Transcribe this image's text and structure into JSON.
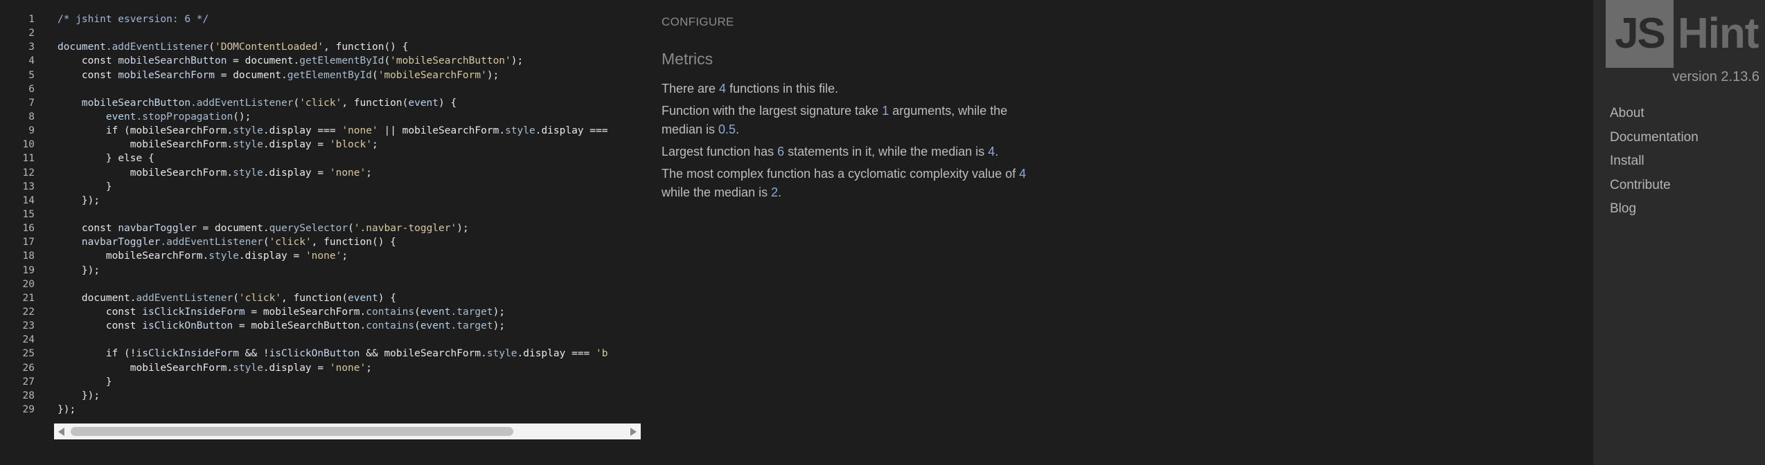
{
  "editor": {
    "line_numbers": [
      "1",
      "2",
      "3",
      "4",
      "5",
      "6",
      "7",
      "8",
      "9",
      "10",
      "11",
      "12",
      "13",
      "14",
      "15",
      "16",
      "17",
      "18",
      "19",
      "20",
      "21",
      "22",
      "23",
      "24",
      "25",
      "26",
      "27",
      "28",
      "29"
    ],
    "lines": [
      [
        [
          "tk-comment",
          "/* jshint esversion: 6 */"
        ]
      ],
      [],
      [
        [
          "tk-var",
          "document"
        ],
        [
          "tk-prop",
          ".addEventListener"
        ],
        [
          "",
          "("
        ],
        [
          "tk-string",
          "'DOMContentLoaded'"
        ],
        [
          "",
          ", "
        ],
        [
          "tk-kw",
          "function"
        ],
        [
          "",
          "() {"
        ]
      ],
      [
        [
          "",
          "    "
        ],
        [
          "tk-kw",
          "const "
        ],
        [
          "tk-var",
          "mobileSearchButton"
        ],
        [
          "",
          " = document."
        ],
        [
          "tk-prop",
          "getElementById"
        ],
        [
          "",
          "("
        ],
        [
          "tk-string",
          "'mobileSearchButton'"
        ],
        [
          "",
          ");"
        ]
      ],
      [
        [
          "",
          "    "
        ],
        [
          "tk-kw",
          "const "
        ],
        [
          "tk-var",
          "mobileSearchForm"
        ],
        [
          "",
          " = document."
        ],
        [
          "tk-prop",
          "getElementById"
        ],
        [
          "",
          "("
        ],
        [
          "tk-string",
          "'mobileSearchForm'"
        ],
        [
          "",
          ");"
        ]
      ],
      [],
      [
        [
          "",
          "    "
        ],
        [
          "tk-var",
          "mobileSearchButton"
        ],
        [
          "tk-prop",
          ".addEventListener"
        ],
        [
          "",
          "("
        ],
        [
          "tk-string",
          "'click'"
        ],
        [
          "",
          ", "
        ],
        [
          "tk-kw",
          "function"
        ],
        [
          "",
          "("
        ],
        [
          "tk-prm",
          "event"
        ],
        [
          "",
          ") {"
        ]
      ],
      [
        [
          "",
          "        "
        ],
        [
          "tk-prm",
          "event"
        ],
        [
          "tk-prop",
          ".stopPropagation"
        ],
        [
          "",
          "();"
        ]
      ],
      [
        [
          "",
          "        "
        ],
        [
          "tk-kw",
          "if "
        ],
        [
          "",
          "(mobileSearchForm."
        ],
        [
          "tk-prop",
          "style"
        ],
        [
          "",
          ".display === "
        ],
        [
          "tk-string",
          "'none'"
        ],
        [
          "",
          " || mobileSearchForm."
        ],
        [
          "tk-prop",
          "style"
        ],
        [
          "",
          ".display === "
        ]
      ],
      [
        [
          "",
          "            mobileSearchForm."
        ],
        [
          "tk-prop",
          "style"
        ],
        [
          "",
          ".display = "
        ],
        [
          "tk-string",
          "'block'"
        ],
        [
          "",
          ";"
        ]
      ],
      [
        [
          "",
          "        } "
        ],
        [
          "tk-kw",
          "else"
        ],
        [
          "",
          " {"
        ]
      ],
      [
        [
          "",
          "            mobileSearchForm."
        ],
        [
          "tk-prop",
          "style"
        ],
        [
          "",
          ".display = "
        ],
        [
          "tk-string",
          "'none'"
        ],
        [
          "",
          ";"
        ]
      ],
      [
        [
          "",
          "        }"
        ]
      ],
      [
        [
          "",
          "    });"
        ]
      ],
      [],
      [
        [
          "",
          "    "
        ],
        [
          "tk-kw",
          "const "
        ],
        [
          "tk-var",
          "navbarToggler"
        ],
        [
          "",
          " = document."
        ],
        [
          "tk-prop",
          "querySelector"
        ],
        [
          "",
          "("
        ],
        [
          "tk-string",
          "'.navbar-toggler'"
        ],
        [
          "",
          ");"
        ]
      ],
      [
        [
          "",
          "    "
        ],
        [
          "tk-var",
          "navbarToggler"
        ],
        [
          "tk-prop",
          ".addEventListener"
        ],
        [
          "",
          "("
        ],
        [
          "tk-string",
          "'click'"
        ],
        [
          "",
          ", "
        ],
        [
          "tk-kw",
          "function"
        ],
        [
          "",
          "() {"
        ]
      ],
      [
        [
          "",
          "        mobileSearchForm."
        ],
        [
          "tk-prop",
          "style"
        ],
        [
          "",
          ".display = "
        ],
        [
          "tk-string",
          "'none'"
        ],
        [
          "",
          ";"
        ]
      ],
      [
        [
          "",
          "    });"
        ]
      ],
      [],
      [
        [
          "",
          "    document."
        ],
        [
          "tk-prop",
          "addEventListener"
        ],
        [
          "",
          "("
        ],
        [
          "tk-string",
          "'click'"
        ],
        [
          "",
          ", "
        ],
        [
          "tk-kw",
          "function"
        ],
        [
          "",
          "("
        ],
        [
          "tk-prm",
          "event"
        ],
        [
          "",
          ") {"
        ]
      ],
      [
        [
          "",
          "        "
        ],
        [
          "tk-kw",
          "const "
        ],
        [
          "tk-var",
          "isClickInsideForm"
        ],
        [
          "",
          " = mobileSearchForm."
        ],
        [
          "tk-prop",
          "contains"
        ],
        [
          "",
          "("
        ],
        [
          "tk-prm",
          "event"
        ],
        [
          "tk-prop",
          ".target"
        ],
        [
          "",
          ");"
        ]
      ],
      [
        [
          "",
          "        "
        ],
        [
          "tk-kw",
          "const "
        ],
        [
          "tk-var",
          "isClickOnButton"
        ],
        [
          "",
          " = mobileSearchButton."
        ],
        [
          "tk-prop",
          "contains"
        ],
        [
          "",
          "("
        ],
        [
          "tk-prm",
          "event"
        ],
        [
          "tk-prop",
          ".target"
        ],
        [
          "",
          ");"
        ]
      ],
      [],
      [
        [
          "",
          "        "
        ],
        [
          "tk-kw",
          "if "
        ],
        [
          "",
          "(!"
        ],
        [
          "tk-var",
          "isClickInsideForm"
        ],
        [
          "",
          " && !"
        ],
        [
          "tk-var",
          "isClickOnButton"
        ],
        [
          "",
          " && mobileSearchForm."
        ],
        [
          "tk-prop",
          "style"
        ],
        [
          "",
          ".display === "
        ],
        [
          "tk-string",
          "'b"
        ]
      ],
      [
        [
          "",
          "            mobileSearchForm."
        ],
        [
          "tk-prop",
          "style"
        ],
        [
          "",
          ".display = "
        ],
        [
          "tk-string",
          "'none'"
        ],
        [
          "",
          ";"
        ]
      ],
      [
        [
          "",
          "        }"
        ]
      ],
      [
        [
          "",
          "    });"
        ]
      ],
      [
        [
          "",
          "});"
        ]
      ]
    ],
    "scrollbar": {
      "thumb_fraction": 0.8,
      "thumb_offset": 0.0
    }
  },
  "report": {
    "configure_label": "CONFIGURE",
    "metrics_title": "Metrics",
    "metrics": [
      [
        [
          "",
          "There are "
        ],
        [
          "num",
          "4"
        ],
        [
          "",
          " functions in this file."
        ]
      ],
      [
        [
          "",
          "Function with the largest signature take "
        ],
        [
          "num",
          "1"
        ],
        [
          "",
          " arguments, while the median is "
        ],
        [
          "num",
          "0.5"
        ],
        [
          "",
          "."
        ]
      ],
      [
        [
          "",
          "Largest function has "
        ],
        [
          "num",
          "6"
        ],
        [
          "",
          " statements in it, while the median is "
        ],
        [
          "num",
          "4"
        ],
        [
          "",
          "."
        ]
      ],
      [
        [
          "",
          "The most complex function has a cyclomatic complexity value of "
        ],
        [
          "num",
          "4"
        ],
        [
          "",
          " while the median is "
        ],
        [
          "num",
          "2"
        ],
        [
          "",
          "."
        ]
      ]
    ]
  },
  "sidebar": {
    "logo_left": "JS",
    "logo_right": "Hint",
    "version": "version 2.13.6",
    "nav": [
      "About",
      "Documentation",
      "Install",
      "Contribute",
      "Blog"
    ]
  }
}
